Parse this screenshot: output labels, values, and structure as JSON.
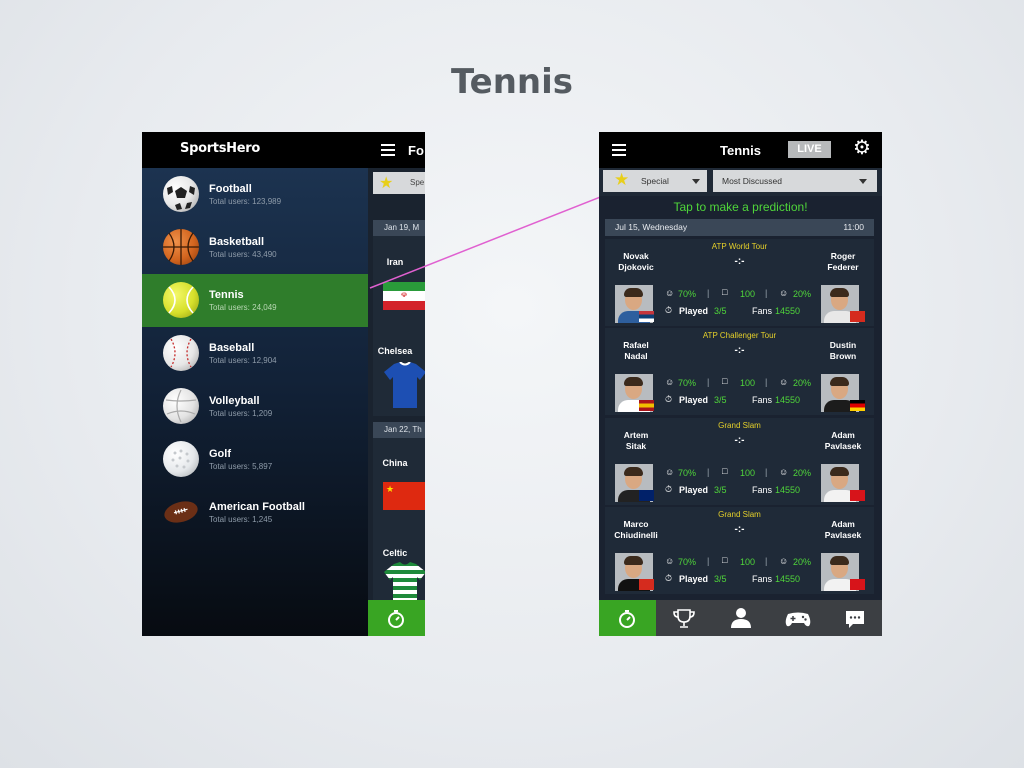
{
  "slide_title": "Tennis",
  "left_phone": {
    "logo": "SportsHero",
    "peek_title": "Fo",
    "peek_filter": "Spe",
    "peek_matches": [
      {
        "date": "Jan 19, M",
        "team_a": "Iran",
        "team_b": "Chelsea"
      },
      {
        "date": "Jan 22, Th",
        "team_a": "China",
        "team_b": "Celtic"
      }
    ],
    "sports": [
      {
        "name": "Football",
        "users": "Total users: 123,989"
      },
      {
        "name": "Basketball",
        "users": "Total users: 43,490"
      },
      {
        "name": "Tennis",
        "users": "Total users: 24,049"
      },
      {
        "name": "Baseball",
        "users": "Total users: 12,904"
      },
      {
        "name": "Volleyball",
        "users": "Total users: 1,209"
      },
      {
        "name": "Golf",
        "users": "Total users: 5,897"
      },
      {
        "name": "American Football",
        "users": "Total users: 1,245"
      }
    ],
    "active_sport": "Tennis",
    "accent_green": "#2f7d2b"
  },
  "right_phone": {
    "title": "Tennis",
    "live_label": "LIVE",
    "filter_special": "Special",
    "filter_sort": "Most Discussed",
    "tap_prompt": "Tap to make a prediction!",
    "date": "Jul 15, Wednesday",
    "time": "11:00",
    "matches": [
      {
        "tour": "ATP World Tour",
        "p1": "Novak\nDjokovic",
        "p2": "Roger\nFederer",
        "score": "-:-",
        "pct1": "70%",
        "comments": "100",
        "pct2": "20%",
        "played_label": "Played",
        "played": "3/5",
        "fans_label": "Fans",
        "fans": "14550"
      },
      {
        "tour": "ATP Challenger Tour",
        "p1": "Rafael\nNadal",
        "p2": "Dustin\nBrown",
        "score": "-:-",
        "pct1": "70%",
        "comments": "100",
        "pct2": "20%",
        "played_label": "Played",
        "played": "3/5",
        "fans_label": "Fans",
        "fans": "14550"
      },
      {
        "tour": "Grand Slam",
        "p1": "Artem\nSitak",
        "p2": "Adam\nPavlasek",
        "score": "-:-",
        "pct1": "70%",
        "comments": "100",
        "pct2": "20%",
        "played_label": "Played",
        "played": "3/5",
        "fans_label": "Fans",
        "fans": "14550"
      },
      {
        "tour": "Grand Slam",
        "p1": "Marco\nChiudinelli",
        "p2": "Adam\nPavlasek",
        "score": "-:-",
        "pct1": "70%",
        "comments": "100",
        "pct2": "20%",
        "played_label": "Played",
        "played": "3/5",
        "fans_label": "Fans",
        "fans": "14550"
      }
    ],
    "tabs": [
      "stopwatch-icon",
      "trophy-icon",
      "user-icon",
      "gamepad-icon",
      "chat-icon"
    ],
    "accent_green": "#39a523",
    "highlight_green": "#4fd53a",
    "tour_yellow": "#e5d02a"
  },
  "annotation_arrow_color": "#e060d0"
}
